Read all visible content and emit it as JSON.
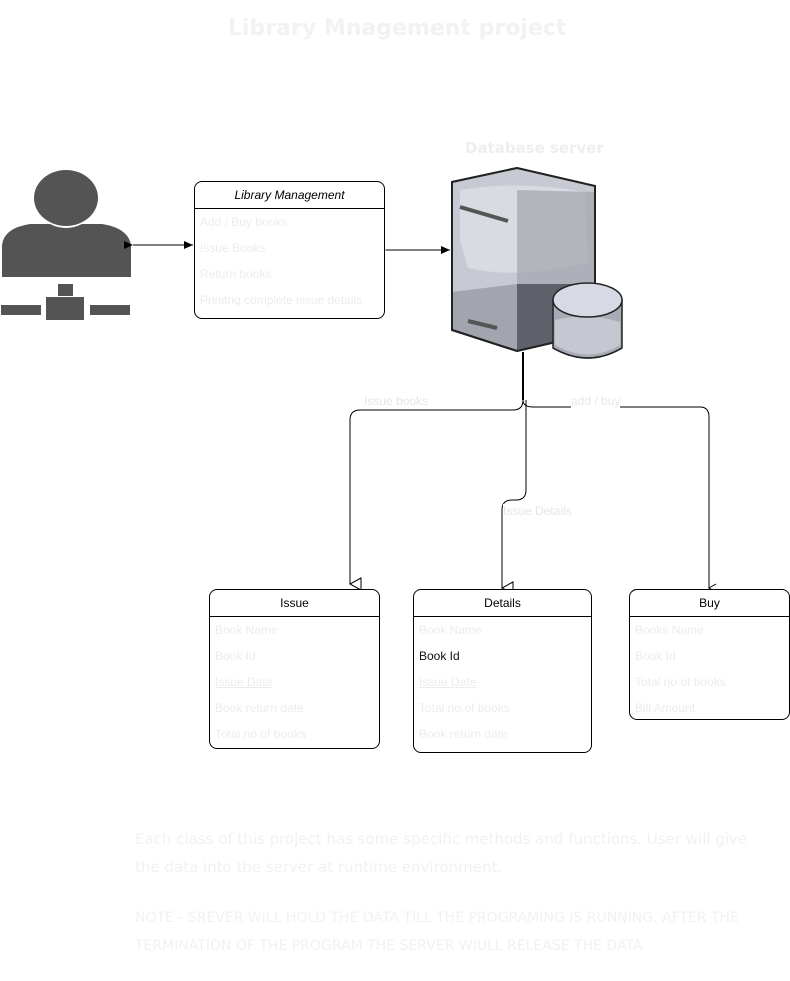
{
  "title": "Library Mnagement project",
  "db_label": "Database server",
  "library": {
    "header": "Library Management",
    "items": [
      "Add / Buy books",
      "Issue Books",
      "Return books",
      "Prinitng complete issue details"
    ]
  },
  "edges": {
    "issue_books": "Issue books",
    "add_buy": "add / buy",
    "issue_details": "Issue Details"
  },
  "issue": {
    "header": "Issue",
    "items": [
      "Book Name",
      "Book Id",
      "Issue Date",
      "Book return date",
      "Total no.of books"
    ]
  },
  "details": {
    "header": "Details",
    "items": [
      "Book Name",
      "Book Id",
      "Issue Date",
      "Total no.of books",
      "Book return date"
    ]
  },
  "buy": {
    "header": "Buy",
    "items": [
      "Books Name",
      "Book Id",
      "Total no.of books",
      "Bill Amount"
    ]
  },
  "notes": {
    "line1": "Each class of this project has some specific methods and functions. User will give the data into the server at runtime environment.",
    "line2": "Note - srever will hold the data till the programing is running. After the termination of the program the server wiull release the data"
  },
  "colors": {
    "user": "#545454",
    "server_light": "#d7dae4",
    "server_mid": "#a2a5ad",
    "server_dark": "#5e6169"
  }
}
